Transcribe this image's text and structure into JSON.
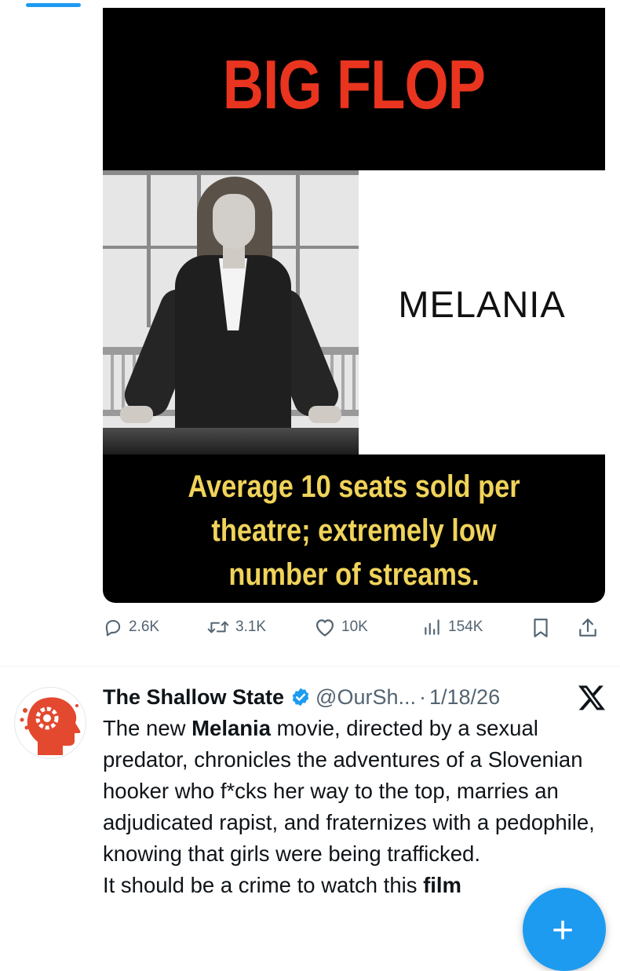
{
  "media": {
    "headline": "BIG FLOP",
    "film_title": "MELANIA",
    "subtitle_lines": [
      "Average 10 seats sold per",
      "theatre; extremely low",
      "number of streams."
    ],
    "colors": {
      "headline": "#e9341f",
      "subtitle": "#f0d35a",
      "background": "#000000"
    }
  },
  "actions": {
    "replies": "2.6K",
    "reposts": "3.1K",
    "likes": "10K",
    "views": "154K",
    "icons": [
      "reply-icon",
      "repost-icon",
      "like-icon",
      "views-icon",
      "bookmark-icon",
      "share-icon"
    ]
  },
  "next_post": {
    "display_name": "The Shallow State",
    "handle": "@OurSh...",
    "separator": "·",
    "date": "1/18/26",
    "body": {
      "p1_before": "The new ",
      "p1_bold": "Melania",
      "p1_after": " movie, directed by a sexual predator, chronicles the adventures of a Slovenian hooker who f*cks her way to the top, marries an adjudicated rapist, and fraternizes with a pedophile, knowing that girls were being trafficked.",
      "p2_before": "It should be a crime to watch this ",
      "p2_bold": "film"
    }
  },
  "compose_fab": {
    "label": "+"
  },
  "colors": {
    "accent": "#1d9bf0",
    "secondary_text": "#536471"
  }
}
